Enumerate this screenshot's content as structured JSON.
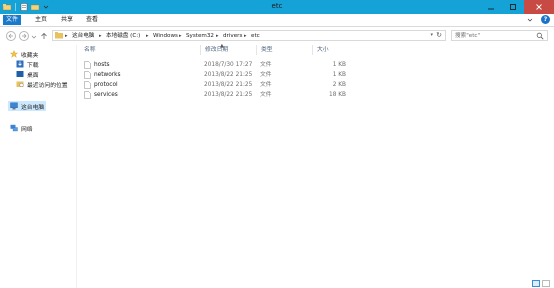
{
  "window": {
    "title": "etc"
  },
  "colors": {
    "titlebar": "#15a2d6",
    "file_tab": "#1979ca",
    "close": "#c74a45",
    "folder": "#e8c25f",
    "selected": "#cce8ff"
  },
  "ribbon": {
    "tabs": [
      "文件",
      "主页",
      "共享",
      "查看"
    ]
  },
  "address": {
    "crumbs": [
      "这台电脑",
      "本地磁盘 (C:)",
      "Windows",
      "System32",
      "drivers",
      "etc"
    ]
  },
  "search": {
    "placeholder": "搜索\"etc\""
  },
  "nav": {
    "favorites_label": "收藏夹",
    "favorites": [
      "下载",
      "桌面",
      "最近访问的位置"
    ],
    "this_pc": "这台电脑",
    "network": "网络"
  },
  "columns": {
    "name": "名称",
    "date": "修改日期",
    "type": "类型",
    "size": "大小"
  },
  "files": [
    {
      "name": "hosts",
      "date": "2018/7/30 17:27",
      "type": "文件",
      "size": "1 KB"
    },
    {
      "name": "networks",
      "date": "2013/8/22 21:25",
      "type": "文件",
      "size": "1 KB"
    },
    {
      "name": "protocol",
      "date": "2013/8/22 21:25",
      "type": "文件",
      "size": "2 KB"
    },
    {
      "name": "services",
      "date": "2013/8/22 21:25",
      "type": "文件",
      "size": "18 KB"
    }
  ]
}
